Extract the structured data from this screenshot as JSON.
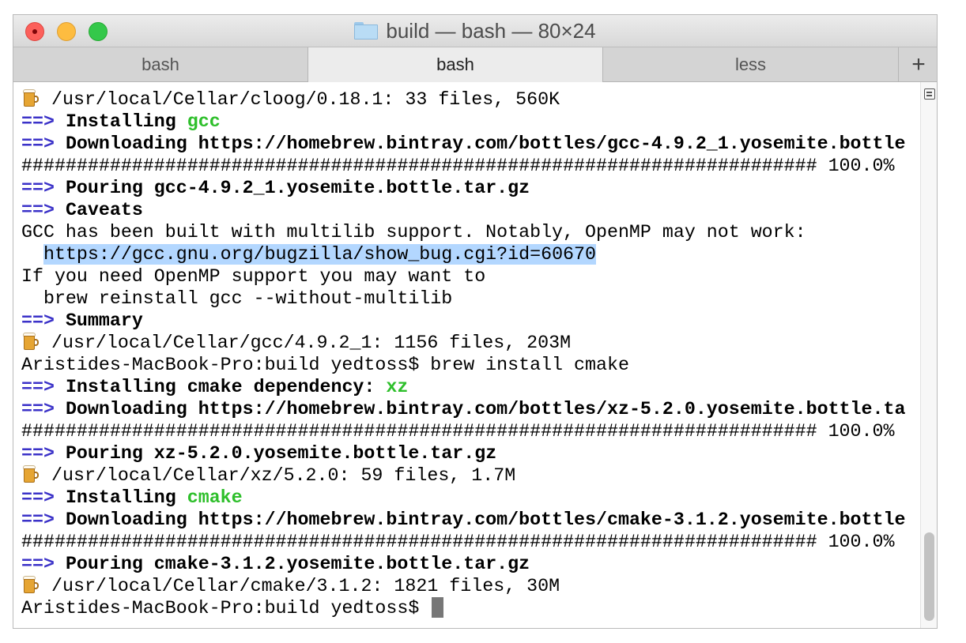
{
  "window": {
    "title": "build — bash — 80×24"
  },
  "tabs": [
    {
      "label": "bash",
      "active": false
    },
    {
      "label": "bash",
      "active": true
    },
    {
      "label": "less",
      "active": false
    }
  ],
  "tab_add_label": "+",
  "terminal": {
    "arrow": "==>",
    "lines": {
      "l1": "/usr/local/Cellar/cloog/0.18.1: 33 files, 560K",
      "l2_text": "Installing ",
      "l2_pkg": "gcc",
      "l3": "Downloading https://homebrew.bintray.com/bottles/gcc-4.9.2_1.yosemite.bottle",
      "l4": "######################################################################## 100.0%",
      "l5": "Pouring gcc-4.9.2_1.yosemite.bottle.tar.gz",
      "l6": "Caveats",
      "l7": "GCC has been built with multilib support. Notably, OpenMP may not work:",
      "l8_indent": "  ",
      "l8_link": "https://gcc.gnu.org/bugzilla/show_bug.cgi?id=60670",
      "l9": "If you need OpenMP support you may want to",
      "l10": "  brew reinstall gcc --without-multilib",
      "l11": "Summary",
      "l12": "/usr/local/Cellar/gcc/4.9.2_1: 1156 files, 203M",
      "l13": "Aristides-MacBook-Pro:build yedtoss$ brew install cmake",
      "l14_text": "Installing cmake dependency: ",
      "l14_pkg": "xz",
      "l15": "Downloading https://homebrew.bintray.com/bottles/xz-5.2.0.yosemite.bottle.ta",
      "l16": "######################################################################## 100.0%",
      "l17": "Pouring xz-5.2.0.yosemite.bottle.tar.gz",
      "l18": "/usr/local/Cellar/xz/5.2.0: 59 files, 1.7M",
      "l19_text": "Installing ",
      "l19_pkg": "cmake",
      "l20": "Downloading https://homebrew.bintray.com/bottles/cmake-3.1.2.yosemite.bottle",
      "l21": "######################################################################## 100.0%",
      "l22": "Pouring cmake-3.1.2.yosemite.bottle.tar.gz",
      "l23": "/usr/local/Cellar/cmake/3.1.2: 1821 files, 30M",
      "l24": "Aristides-MacBook-Pro:build yedtoss$ "
    }
  },
  "colors": {
    "arrow": "#3b32c8",
    "package_highlight": "#2ebf2b",
    "selection": "#b3d7ff",
    "close": "#fc605b",
    "minimize": "#fdbc40",
    "maximize": "#34c84a"
  },
  "icons": {
    "title": "folder-icon",
    "beer": "beer-mug-icon",
    "scroll_toggle": "scroll-mode-icon"
  }
}
